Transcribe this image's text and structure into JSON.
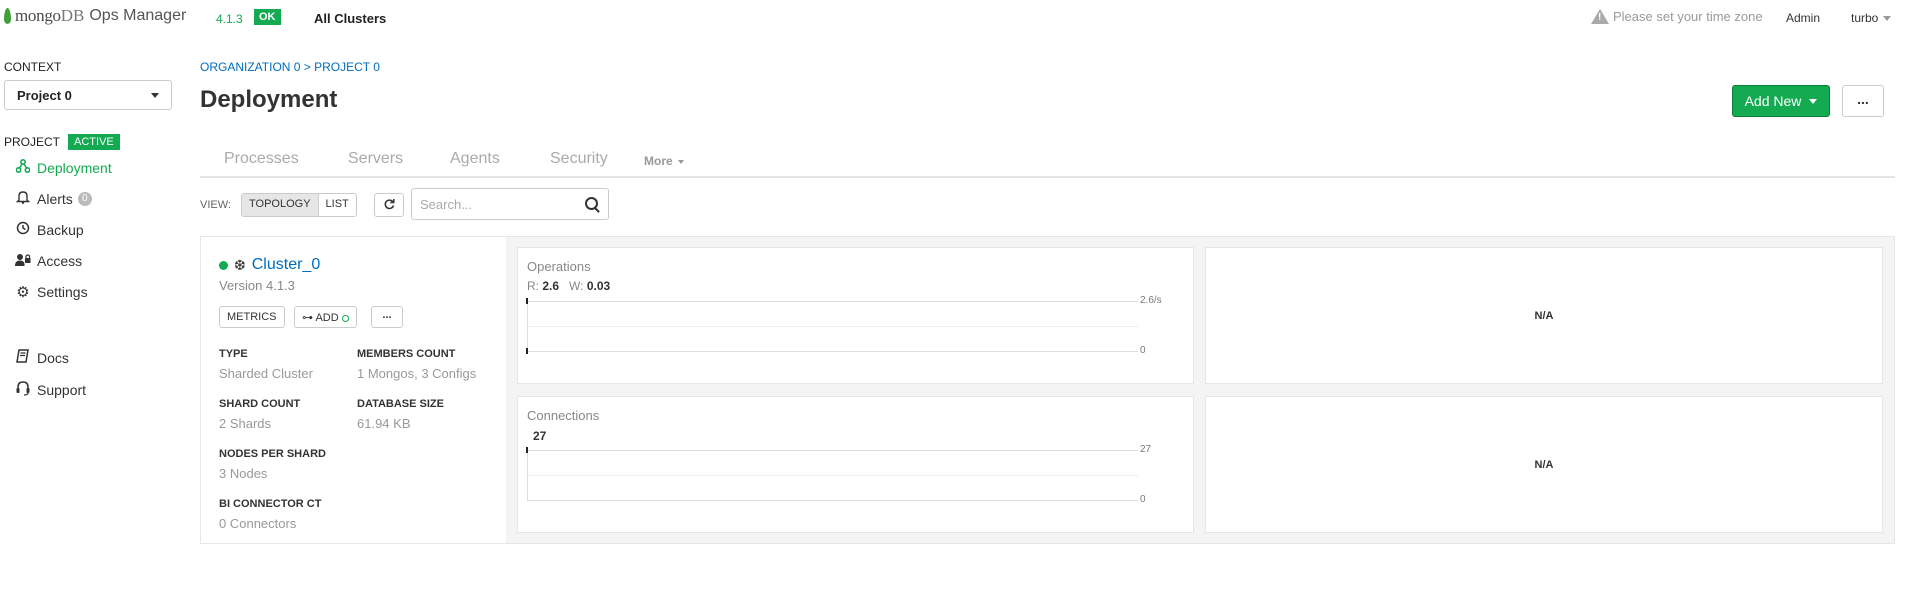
{
  "topbar": {
    "logo_mongo": "mongo",
    "logo_db": "DB",
    "logo_product": "Ops Manager",
    "version": "4.1.3",
    "status": "OK",
    "all_clusters": "All Clusters",
    "timezone_warning": "Please set your time zone",
    "admin": "Admin",
    "user": "turbo"
  },
  "sidebar": {
    "context_label": "CONTEXT",
    "context_value": "Project 0",
    "project_label": "PROJECT",
    "project_status": "ACTIVE",
    "items": [
      {
        "label": "Deployment",
        "icon": "deployment-icon"
      },
      {
        "label": "Alerts",
        "icon": "bell-icon",
        "count": "0"
      },
      {
        "label": "Backup",
        "icon": "clock-icon"
      },
      {
        "label": "Access",
        "icon": "user-lock-icon"
      },
      {
        "label": "Settings",
        "icon": "gear-icon"
      }
    ],
    "links": [
      {
        "label": "Docs",
        "icon": "book-icon"
      },
      {
        "label": "Support",
        "icon": "headset-icon"
      }
    ]
  },
  "main": {
    "breadcrumb": "ORGANIZATION 0 > PROJECT 0",
    "title": "Deployment",
    "add_new": "Add New",
    "more": "...",
    "tabs": [
      "Processes",
      "Servers",
      "Agents",
      "Security"
    ],
    "tab_more": "More",
    "view_label": "VIEW:",
    "view_topology": "TOPOLOGY",
    "view_list": "LIST",
    "search_placeholder": "Search..."
  },
  "cluster": {
    "name": "Cluster_0",
    "version": "Version 4.1.3",
    "metrics_btn": "METRICS",
    "add_btn": "ADD",
    "more_btn": "...",
    "type_label": "TYPE",
    "type_value": "Sharded Cluster",
    "members_label": "MEMBERS COUNT",
    "members_value": "1 Mongos, 3 Configs",
    "shard_label": "SHARD COUNT",
    "shard_value": "2 Shards",
    "dbsize_label": "DATABASE SIZE",
    "dbsize_value": "61.94 KB",
    "nodes_label": "NODES PER SHARD",
    "nodes_value": "3 Nodes",
    "bi_label": "BI CONNECTOR CT",
    "bi_value": "0 Connectors"
  },
  "panels": {
    "operations": {
      "title": "Operations",
      "r_label": "R:",
      "r_value": "2.6",
      "w_label": "W:",
      "w_value": "0.03",
      "max_label": "2.6/s",
      "min_label": "0"
    },
    "connections": {
      "title": "Connections",
      "value": "27",
      "max_label": "27",
      "min_label": "0"
    },
    "na_1": "N/A",
    "na_2": "N/A"
  },
  "colors": {
    "accent_green": "#13AA52",
    "link_blue": "#006CBC"
  }
}
